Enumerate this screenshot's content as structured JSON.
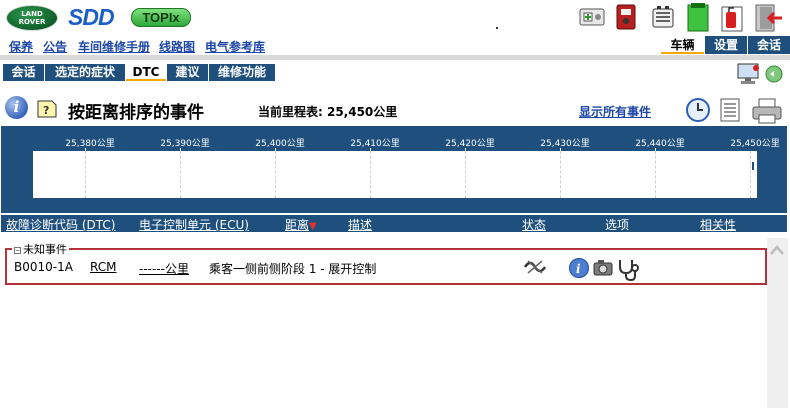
{
  "brand": {
    "logo_text": "LAND ROVER",
    "app_name": "SDD",
    "topix": "TOPIx"
  },
  "top_nav": {
    "links": [
      "保养",
      "公告",
      "车间维修手册",
      "线路图",
      "电气参考库"
    ],
    "right_tabs": [
      {
        "label": "车辆",
        "active": true
      },
      {
        "label": "设置",
        "active": false
      },
      {
        "label": "会话",
        "active": false
      }
    ]
  },
  "sub_tabs": [
    {
      "label": "会话",
      "active": false
    },
    {
      "label": "选定的症状",
      "active": false
    },
    {
      "label": "DTC",
      "active": true
    },
    {
      "label": "建议",
      "active": false
    },
    {
      "label": "维修功能",
      "active": false
    }
  ],
  "title_bar": {
    "title": "按距离排序的事件",
    "odometer_label": "当前里程表: 25,450公里",
    "show_all_link": "显示所有事件"
  },
  "timeline": {
    "tick_labels": [
      "25,380公里",
      "25,390公里",
      "25,400公里",
      "25,410公里",
      "25,420公里",
      "25,430公里",
      "25,440公里",
      "25,450公里"
    ]
  },
  "columns": {
    "dtc": "故障诊断代码 (DTC)",
    "ecu": "电子控制单元 (ECU)",
    "distance": "距离",
    "description": "描述",
    "status": "状态",
    "options": "选项",
    "relevance": "相关性"
  },
  "event_group": {
    "label": "未知事件",
    "row": {
      "dtc": "B0010-1A",
      "ecu": "RCM",
      "distance": "------公里",
      "description": "乘客一侧前侧阶段 1 - 展开控制"
    }
  },
  "colors": {
    "navy": "#1f4f7c",
    "link": "#1d47a7",
    "accent": "#f5a800",
    "group_border": "#b5323a"
  }
}
